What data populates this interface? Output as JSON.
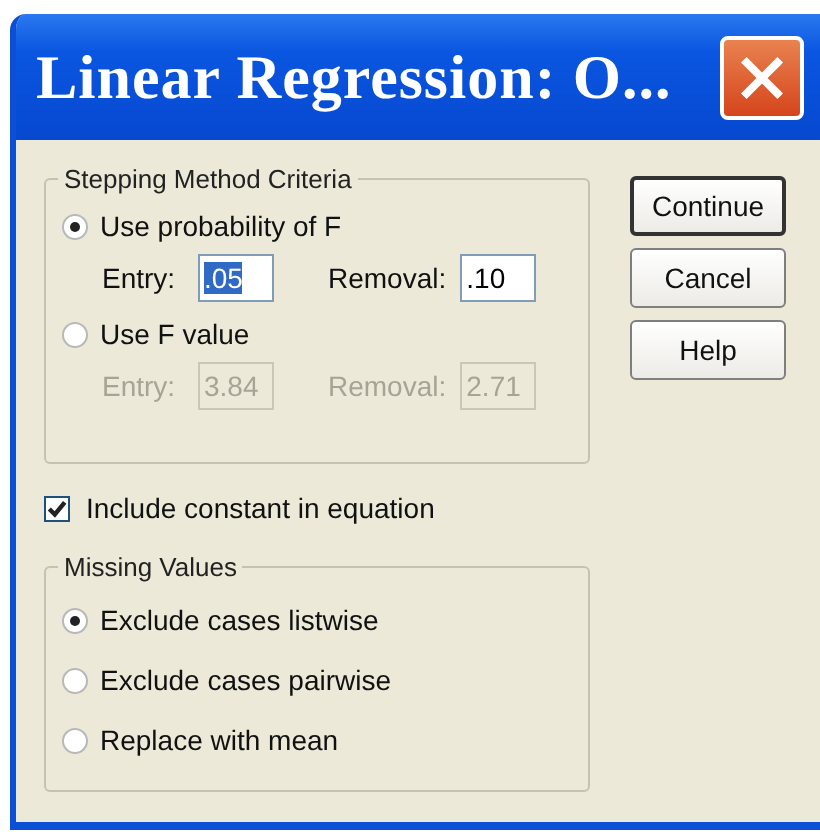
{
  "window": {
    "title": "Linear Regression: O..."
  },
  "stepping_method": {
    "title": "Stepping Method Criteria",
    "options": [
      {
        "label": "Use probability of F",
        "selected": true,
        "fields": [
          {
            "label": "Entry:",
            "value": ".05",
            "disabled": false,
            "highlighted": true
          },
          {
            "label": "Removal:",
            "value": ".10",
            "disabled": false,
            "highlighted": false
          }
        ]
      },
      {
        "label": "Use F value",
        "selected": false,
        "fields": [
          {
            "label": "Entry:",
            "value": "3.84",
            "disabled": true,
            "highlighted": false
          },
          {
            "label": "Removal:",
            "value": "2.71",
            "disabled": true,
            "highlighted": false
          }
        ]
      }
    ]
  },
  "include_constant": {
    "label": "Include constant in equation",
    "checked": true
  },
  "missing_values": {
    "title": "Missing Values",
    "options": [
      {
        "label": "Exclude cases listwise",
        "selected": true
      },
      {
        "label": "Exclude cases pairwise",
        "selected": false
      },
      {
        "label": "Replace with mean",
        "selected": false
      }
    ]
  },
  "buttons": [
    {
      "label": "Continue",
      "default": true
    },
    {
      "label": "Cancel",
      "default": false
    },
    {
      "label": "Help",
      "default": false
    }
  ]
}
